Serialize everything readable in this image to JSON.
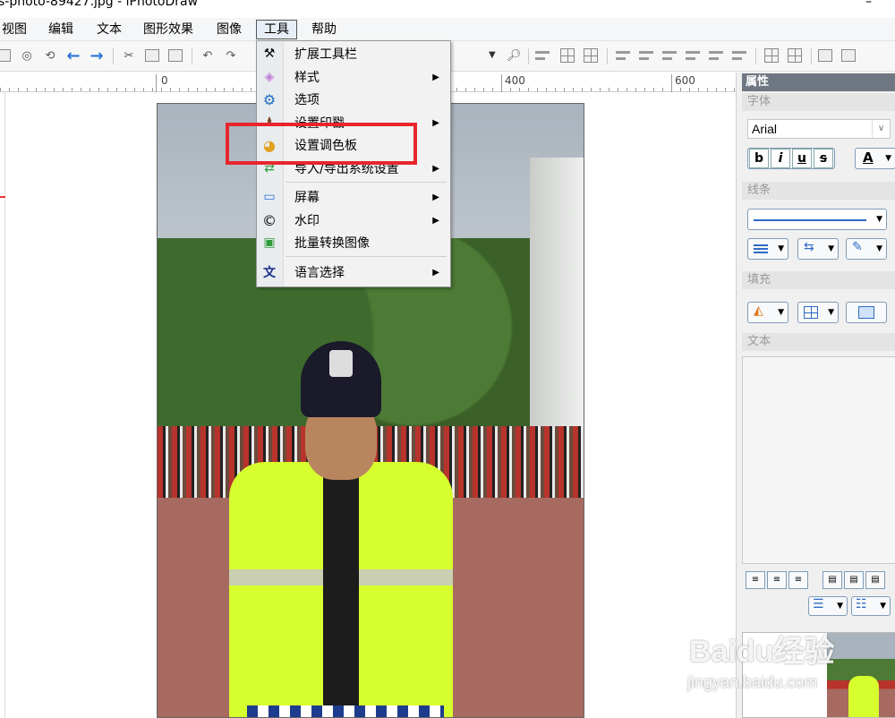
{
  "window": {
    "title": "s-photo-89427.jpg - iPhotoDraw",
    "minimize": "–"
  },
  "menubar": {
    "items": [
      {
        "label": "视图"
      },
      {
        "label": "编辑"
      },
      {
        "label": "文本"
      },
      {
        "label": "图形效果"
      },
      {
        "label": "图像"
      },
      {
        "label": "工具"
      },
      {
        "label": "帮助"
      }
    ]
  },
  "ruler": {
    "labels": [
      "0",
      "400",
      "600"
    ]
  },
  "tools_menu": {
    "items": [
      {
        "label": "扩展工具栏",
        "icon": "tools-icon",
        "submenu": false
      },
      {
        "label": "样式",
        "icon": "style-gem-icon",
        "submenu": true
      },
      {
        "label": "选项",
        "icon": "gear-icon",
        "submenu": false
      },
      {
        "label": "设置印戳",
        "icon": "stamp-icon",
        "submenu": true
      },
      {
        "label": "设置调色板",
        "icon": "palette-icon",
        "submenu": false
      },
      {
        "label": "导入/导出系统设置",
        "icon": "import-export-icon",
        "submenu": true
      },
      {
        "label": "屏幕",
        "icon": "monitor-icon",
        "submenu": true
      },
      {
        "label": "水印",
        "icon": "copyright-icon",
        "submenu": true
      },
      {
        "label": "批量转换图像",
        "icon": "batch-convert-icon",
        "submenu": false
      },
      {
        "label": "语言选择",
        "icon": "language-icon",
        "submenu": true
      }
    ],
    "highlighted": "设置调色板"
  },
  "properties_panel": {
    "title": "属性",
    "font_group": "字体",
    "font_name": "Arial",
    "bold": "b",
    "italic": "i",
    "underline": "u",
    "strike": "s",
    "font_color": "A",
    "line_group": "线条",
    "fill_group": "填充",
    "text_group": "文本"
  },
  "watermark": {
    "logo": "Baidu经验",
    "url": "jingyan.baidu.com"
  },
  "colors": {
    "highlight_box": "#e8252d",
    "panel_title_bg": "#6f7782",
    "toolbar_arrow": "#2a73d8"
  }
}
